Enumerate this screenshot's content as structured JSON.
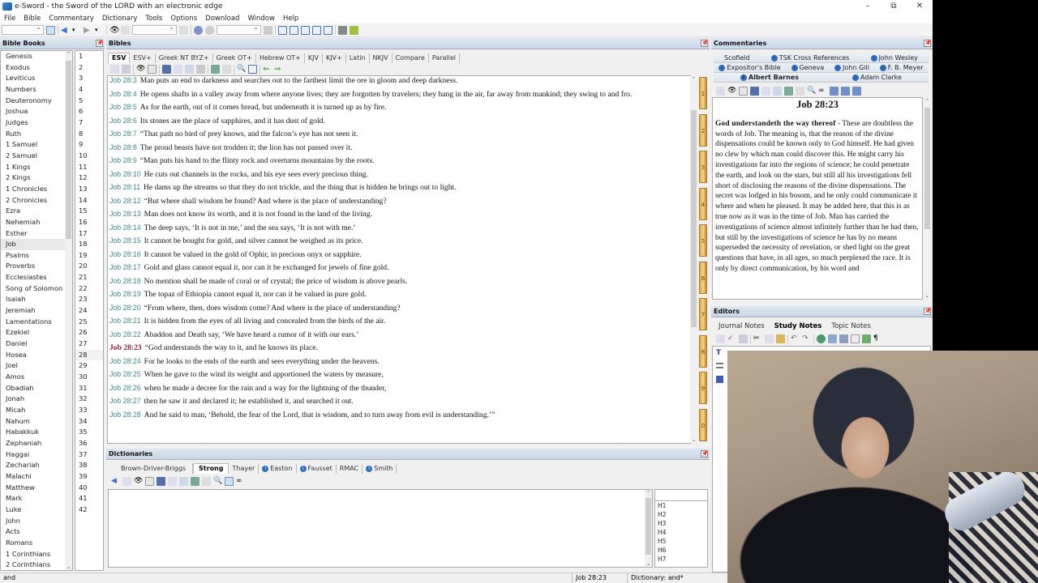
{
  "window": {
    "title": "e-Sword - the Sword of the LORD with an electronic edge",
    "controls": [
      "–",
      "⧉",
      "✕"
    ]
  },
  "menu": [
    "File",
    "Bible",
    "Commentary",
    "Dictionary",
    "Tools",
    "Options",
    "Download",
    "Window",
    "Help"
  ],
  "panes": {
    "bible_books": "Bible Books",
    "bibles": "Bibles",
    "commentaries": "Commentaries",
    "dictionaries": "Dictionaries",
    "editors": "Editors",
    "pin": "↕"
  },
  "books": [
    "Genesis",
    "Exodus",
    "Leviticus",
    "Numbers",
    "Deuteronomy",
    "Joshua",
    "Judges",
    "Ruth",
    "1 Samuel",
    "2 Samuel",
    "1 Kings",
    "2 Kings",
    "1 Chronicles",
    "2 Chronicles",
    "Ezra",
    "Nehemiah",
    "Esther",
    "Job",
    "Psalms",
    "Proverbs",
    "Ecclesiastes",
    "Song of Solomon",
    "Isaiah",
    "Jeremiah",
    "Lamentations",
    "Ezekiel",
    "Daniel",
    "Hosea",
    "Joel",
    "Amos",
    "Obadiah",
    "Jonah",
    "Micah",
    "Nahum",
    "Habakkuk",
    "Zephaniah",
    "Haggai",
    "Zechariah",
    "Malachi",
    "Matthew",
    "Mark",
    "Luke",
    "John",
    "Acts",
    "Romans",
    "1 Corinthians",
    "2 Corinthians"
  ],
  "selected_book": "Job",
  "chapters": [
    "1",
    "2",
    "3",
    "4",
    "5",
    "6",
    "7",
    "8",
    "9",
    "10",
    "11",
    "12",
    "13",
    "14",
    "15",
    "16",
    "17",
    "18",
    "19",
    "20",
    "21",
    "22",
    "23",
    "24",
    "25",
    "26",
    "27",
    "28",
    "29",
    "30",
    "31",
    "32",
    "33",
    "34",
    "35",
    "36",
    "37",
    "38",
    "39",
    "40",
    "41",
    "42"
  ],
  "selected_chapter": "28",
  "search_text": "and",
  "bible_tabs": [
    "ESV",
    "ESV+",
    "Greek NT BYZ+",
    "Greek OT+",
    "Hebrew OT+",
    "KJV",
    "KJV+",
    "Latin",
    "NKJV",
    "Compare",
    "Parallel"
  ],
  "active_bible_tab": "ESV",
  "verses": [
    {
      "ref": "Job 28:3",
      "text": "Man puts an end to darkness and searches out to the farthest limit the ore in gloom and deep darkness."
    },
    {
      "ref": "Job 28:4",
      "text": "He opens shafts in a valley away from where anyone lives; they are forgotten by travelers; they hang in the air, far away from mankind; they swing to and fro."
    },
    {
      "ref": "Job 28:5",
      "text": "As for the earth, out of it comes bread, but underneath it is turned up as by fire."
    },
    {
      "ref": "Job 28:6",
      "text": "Its stones are the place of sapphires, and it has dust of gold."
    },
    {
      "ref": "Job 28:7",
      "text": "“That path no bird of prey knows, and the falcon’s eye has not seen it."
    },
    {
      "ref": "Job 28:8",
      "text": "The proud beasts have not trodden it; the lion has not passed over it."
    },
    {
      "ref": "Job 28:9",
      "text": "“Man puts his hand to the flinty rock and overturns mountains by the roots."
    },
    {
      "ref": "Job 28:10",
      "text": "He cuts out channels in the rocks, and his eye sees every precious thing."
    },
    {
      "ref": "Job 28:11",
      "text": "He dams up the streams so that they do not trickle, and the thing that is hidden he brings out to light."
    },
    {
      "ref": "Job 28:12",
      "text": "“But where shall wisdom be found? And where is the place of understanding?"
    },
    {
      "ref": "Job 28:13",
      "text": "Man does not know its worth, and it is not found in the land of the living."
    },
    {
      "ref": "Job 28:14",
      "text": "The deep says, ‘It is not in me,’ and the sea says, ‘It is not with me.’"
    },
    {
      "ref": "Job 28:15",
      "text": "It cannot be bought for gold, and silver cannot be weighed as its price."
    },
    {
      "ref": "Job 28:16",
      "text": "It cannot be valued in the gold of Ophir, in precious onyx or sapphire."
    },
    {
      "ref": "Job 28:17",
      "text": "Gold and glass cannot equal it, nor can it be exchanged for jewels of fine gold."
    },
    {
      "ref": "Job 28:18",
      "text": "No mention shall be made of coral or of crystal; the price of wisdom is above pearls."
    },
    {
      "ref": "Job 28:19",
      "text": "The topaz of Ethiopia cannot equal it, nor can it be valued in pure gold."
    },
    {
      "ref": "Job 28:20",
      "text": "“From where, then, does wisdom come? And where is the place of understanding?"
    },
    {
      "ref": "Job 28:21",
      "text": "It is hidden from the eyes of all living and concealed from the birds of the air."
    },
    {
      "ref": "Job 28:22",
      "text": "Abaddon and Death say, ‘We have heard a rumor of it with our ears.’"
    },
    {
      "ref": "Job 28:23",
      "text": "“God understands the way to it, and he knows its place.",
      "current": true
    },
    {
      "ref": "Job 28:24",
      "text": "For he looks to the ends of the earth and sees everything under the heavens."
    },
    {
      "ref": "Job 28:25",
      "text": "When he gave to the wind its weight and apportioned the waters by measure,"
    },
    {
      "ref": "Job 28:26",
      "text": "when he made a decree for the rain and a way for the lightning of the thunder,"
    },
    {
      "ref": "Job 28:27",
      "text": "then he saw it and declared it; he established it, and searched it out."
    },
    {
      "ref": "Job 28:28",
      "text": "And he said to man, ‘Behold, the fear of the Lord, that is wisdom, and to turn away from evil is understanding.’”"
    }
  ],
  "bookmarks": [
    "1",
    "2",
    "3",
    "4",
    "5",
    "6",
    "7",
    "8",
    "9",
    "0"
  ],
  "dictionary_tabs": [
    {
      "label": "Brown-Driver-Briggs",
      "info": false
    },
    {
      "label": "Strong",
      "info": false,
      "active": true
    },
    {
      "label": "Thayer",
      "info": false
    },
    {
      "label": "Easton",
      "info": true
    },
    {
      "label": "Fausset",
      "info": true
    },
    {
      "label": "RMAC",
      "info": false
    },
    {
      "label": "Smith",
      "info": true
    }
  ],
  "dictionary_entries": [
    "H1",
    "H2",
    "H3",
    "H4",
    "H5",
    "H6",
    "H7"
  ],
  "commentary_tabs": [
    [
      {
        "label": "Scofield",
        "info": false
      },
      {
        "label": "TSK Cross References",
        "info": true
      },
      {
        "label": "John Wesley",
        "info": true
      }
    ],
    [
      {
        "label": "Expositor's Bible",
        "info": true
      },
      {
        "label": "Geneva",
        "info": true
      },
      {
        "label": "John Gill",
        "info": true
      },
      {
        "label": "F. B. Meyer",
        "info": true
      }
    ],
    [
      {
        "label": "Albert Barnes",
        "info": true,
        "active": true
      },
      {
        "label": "Adam Clarke",
        "info": true
      }
    ]
  ],
  "commentary": {
    "heading": "Job 28:23",
    "lead": "God understandeth the way thereof",
    "body": " - These are doubtless the words of Job. The meaning is, that the reason of the divine dispensations could be known only to God himself. He had given no clew by which man could discover this. He might carry his investigations far into the regions of science; he could penetrate the earth, and look on the stars, but still all his investigations fell short of disclosing the reasons of the divine dispensations. The secret was lodged in his bosom, and he only could communicate it where and when he pleased. It may be added here, that this is as true now as it was in the time of Job. Man has carried the investigations of science almost infinitely further than he had then, but still by the investigations of science he has by no means superseded the necessity of revelation, or shed light on the great questions that have, in all ages, so much perplexed the race. It is only by direct communication, by his word and"
  },
  "editor_tabs": [
    {
      "label": "Journal Notes"
    },
    {
      "label": "Study Notes",
      "active": true
    },
    {
      "label": "Topic Notes"
    }
  ],
  "status": {
    "search": "and",
    "reference": "Job 28:23",
    "dictionary": "Dictionary: and*"
  },
  "colors": {
    "verse_ref": "#3e8a88",
    "current_verse_ref": "#8a1f3a",
    "pane_header": "#c8d6e6"
  }
}
